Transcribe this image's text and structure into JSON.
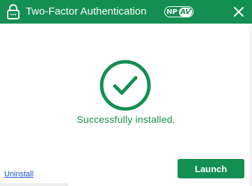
{
  "window": {
    "title": "Two-Factor Authentication",
    "brand": {
      "np": "NP",
      "av": "AV"
    }
  },
  "icons": {
    "lock": "lock-icon",
    "close": "close-icon",
    "check": "checkmark-icon"
  },
  "main": {
    "status_text": "Successfully installed."
  },
  "footer": {
    "uninstall_label": "Uninstall",
    "launch_label": "Launch"
  },
  "colors": {
    "accent": "#148f52",
    "link": "#1a57c9"
  }
}
